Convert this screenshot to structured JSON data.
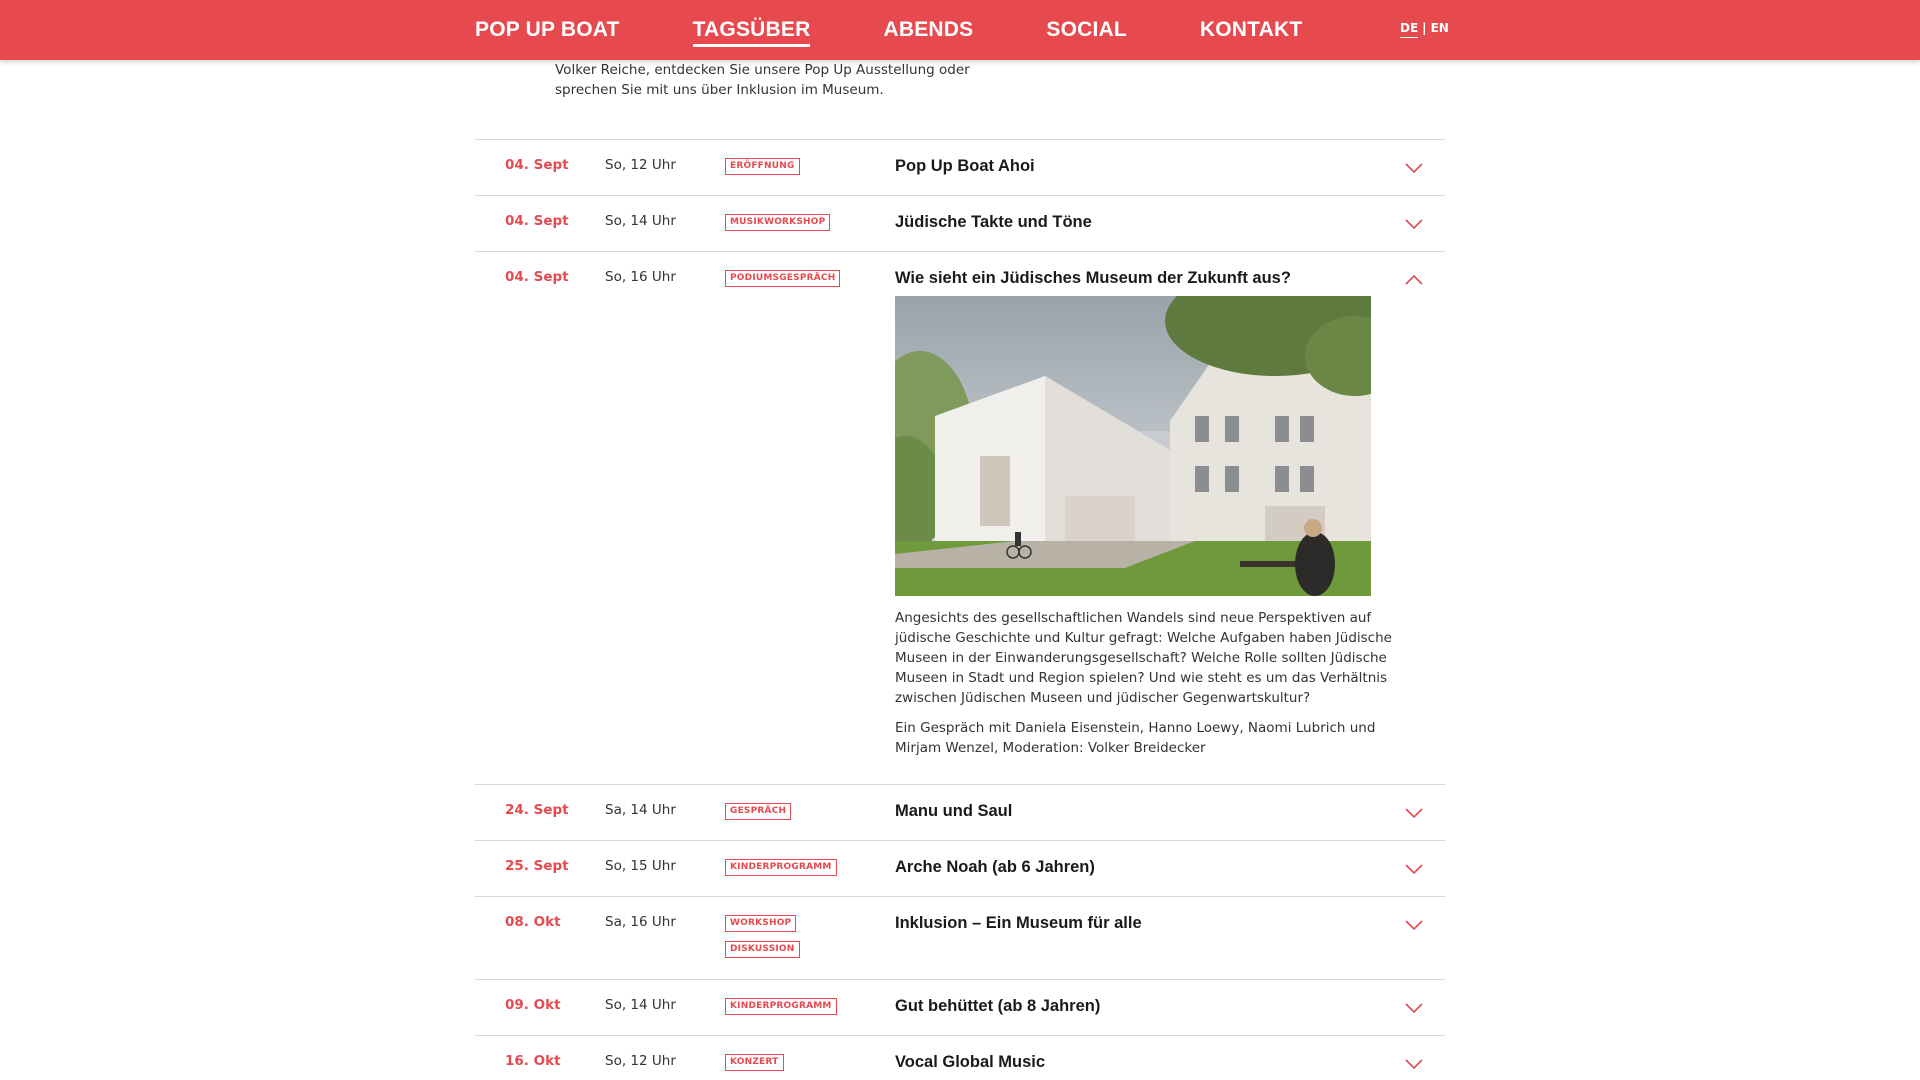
{
  "nav": {
    "items": [
      "POP UP BOAT",
      "TAGSÜBER",
      "ABENDS",
      "SOCIAL",
      "KONTAKT"
    ],
    "active_index": 1,
    "lang": {
      "de": "DE",
      "sep": "|",
      "en": "EN",
      "selected": "DE"
    }
  },
  "intro": {
    "line1": "Volker Reiche, entdecken Sie unsere Pop Up Ausstellung oder",
    "line2": "sprechen Sie mit uns über Inklusion im Museum."
  },
  "events": [
    {
      "date": "04. Sept",
      "time": "So, 12 Uhr",
      "tags": [
        "ERÖFFNUNG"
      ],
      "title": "Pop Up Boat Ahoi"
    },
    {
      "date": "04. Sept",
      "time": "So, 14 Uhr",
      "tags": [
        "MUSIKWORKSHOP"
      ],
      "title": "Jüdische Takte und Töne"
    },
    {
      "date": "04. Sept",
      "time": "So, 16 Uhr",
      "tags": [
        "PODIUMSGESPRÄCH"
      ],
      "title": "Wie sieht ein Jüdisches Museum der Zukunft aus?",
      "expanded": true,
      "description1": "Angesichts des gesellschaftlichen Wandels sind neue Perspektiven auf jüdische Geschichte und Kultur gefragt: Welche Aufgaben haben Jüdische Museen in der Einwanderungsgesellschaft? Welche Rolle sollten Jüdische Museen in Stadt und Region spielen? Und wie steht es um das Verhältnis zwischen Jüdischen Museen und jüdischer Gegenwartskultur?",
      "description2": "Ein Gespräch mit Daniela Eisenstein, Hanno Loewy, Naomi Lubrich und Mirjam Wenzel, Moderation: Volker Breidecker"
    },
    {
      "date": "24. Sept",
      "time": "Sa, 14 Uhr",
      "tags": [
        "GESPRÄCH"
      ],
      "title": "Manu und Saul"
    },
    {
      "date": "25. Sept",
      "time": "So, 15 Uhr",
      "tags": [
        "KINDERPROGRAMM"
      ],
      "title": "Arche Noah (ab 6 Jahren)"
    },
    {
      "date": "08. Okt",
      "time": "Sa, 16 Uhr",
      "tags": [
        "WORKSHOP",
        "DISKUSSION"
      ],
      "title": "Inklusion – Ein Museum für alle"
    },
    {
      "date": "09. Okt",
      "time": "So, 14 Uhr",
      "tags": [
        "KINDERPROGRAMM"
      ],
      "title": "Gut behüttet (ab 8 Jahren)"
    },
    {
      "date": "16. Okt",
      "time": "So, 12 Uhr",
      "tags": [
        "KONZERT"
      ],
      "title": "Vocal Global Music"
    }
  ],
  "colors": {
    "accent": "#e64a4f",
    "text": "#1a1a1a",
    "divider": "#d9d9d9"
  },
  "icons": {
    "collapsed": "chevron-down-icon",
    "expanded": "chevron-up-icon"
  }
}
